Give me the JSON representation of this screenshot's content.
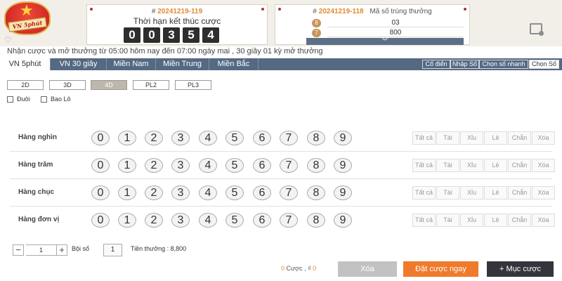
{
  "header": {
    "logo_text": "VN 5phút",
    "current_draw": {
      "prefix": "# ",
      "draw_id": "20241219-119",
      "label": "Thời hạn kết thúc cược",
      "countdown_digits": [
        "0",
        "0",
        "3",
        "5",
        "4"
      ]
    },
    "last_draw": {
      "prefix": "# ",
      "draw_id": "20241219-118",
      "label": "Mã số trúng thưởng",
      "results": [
        {
          "badge": "8",
          "value": "03"
        },
        {
          "badge": "7",
          "value": "800"
        }
      ],
      "more_glyph": "︾"
    },
    "notice": "Nhận cược và mở thưởng từ 05:00 hôm nay đến 07:00 ngày mai ,  30 giây 01 kỳ mở thưởng"
  },
  "tabs": [
    {
      "label": "VN 5phút",
      "active": true
    },
    {
      "label": "VN 30 giây",
      "active": false
    },
    {
      "label": "Miền Nam",
      "active": false
    },
    {
      "label": "Miền Trung",
      "active": false
    },
    {
      "label": "Miền Bắc",
      "active": false
    }
  ],
  "mode_tabs": [
    {
      "label": "Cổ điển",
      "active": false
    },
    {
      "label": "Nhập Số",
      "active": false
    },
    {
      "label": "Chọn số nhanh",
      "active": false
    },
    {
      "label": "Chọn Số",
      "active": true
    }
  ],
  "bet_types": [
    {
      "label": "2D",
      "active": false
    },
    {
      "label": "3D",
      "active": false
    },
    {
      "label": "4D",
      "active": true
    },
    {
      "label": "PL2",
      "active": false
    },
    {
      "label": "PL3",
      "active": false
    }
  ],
  "options": [
    {
      "label": "Đuôi",
      "checked": false
    },
    {
      "label": "Bao Lô",
      "checked": false
    }
  ],
  "digit_rows": [
    {
      "label": "Hàng nghìn"
    },
    {
      "label": "Hàng trăm"
    },
    {
      "label": "Hàng chục"
    },
    {
      "label": "Hàng đơn vị"
    }
  ],
  "digits": [
    "0",
    "1",
    "2",
    "3",
    "4",
    "5",
    "6",
    "7",
    "8",
    "9"
  ],
  "quick_buttons": [
    "Tất cả",
    "Tài",
    "Xỉu",
    "Lẻ",
    "Chẵn",
    "Xóa"
  ],
  "footer": {
    "stepper_minus": "−",
    "stepper_value": "1",
    "stepper_plus": "+",
    "multiplier_label": "Bội số",
    "multiplier_value": "1",
    "prize_text": "Tiền thưởng :  8,800",
    "bet_count": "0",
    "bet_count_label": " Cược , ",
    "currency_symbol": "₫",
    "amount": "0",
    "clear_label": "Xóa",
    "place_bet_label": "Đặt cược ngay",
    "add_bet_label": "+ Mục cược"
  },
  "colors": {
    "accent_orange": "#ef7a2c",
    "tab_bar": "#556982",
    "header_bg": "#f2efe9",
    "dark_button": "#34343c"
  }
}
